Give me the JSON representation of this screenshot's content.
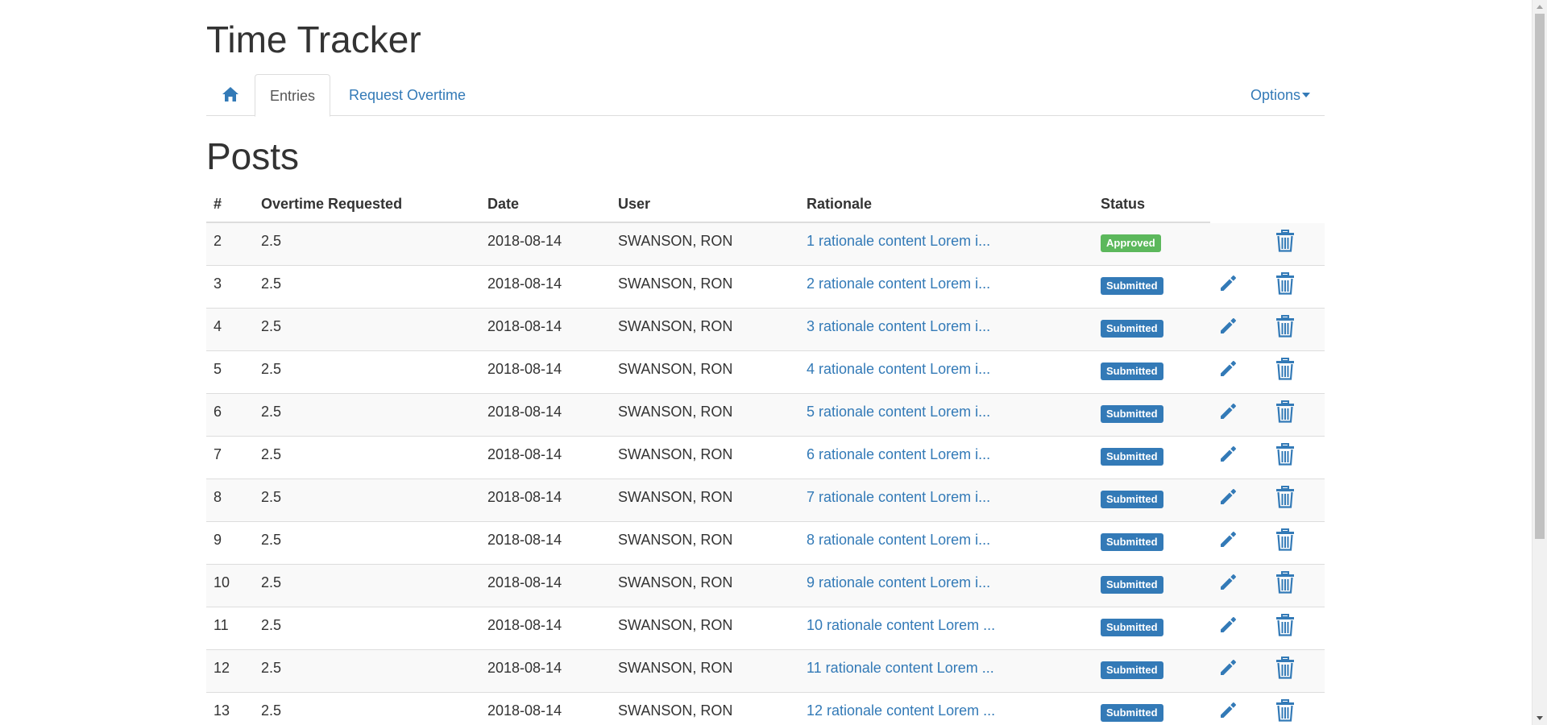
{
  "app": {
    "title": "Time Tracker"
  },
  "nav": {
    "home_icon": "home-icon",
    "tabs": [
      {
        "label": "Entries",
        "active": true
      },
      {
        "label": "Request Overtime",
        "active": false
      }
    ],
    "options_label": "Options"
  },
  "page": {
    "title": "Posts"
  },
  "table": {
    "headers": [
      "#",
      "Overtime Requested",
      "Date",
      "User",
      "Rationale",
      "Status"
    ],
    "rows": [
      {
        "num": "2",
        "overtime": "2.5",
        "date": "2018-08-14",
        "user": "SWANSON, RON",
        "rationale": "1 rationale content Lorem i...",
        "status": "Approved",
        "editable": false
      },
      {
        "num": "3",
        "overtime": "2.5",
        "date": "2018-08-14",
        "user": "SWANSON, RON",
        "rationale": "2 rationale content Lorem i...",
        "status": "Submitted",
        "editable": true
      },
      {
        "num": "4",
        "overtime": "2.5",
        "date": "2018-08-14",
        "user": "SWANSON, RON",
        "rationale": "3 rationale content Lorem i...",
        "status": "Submitted",
        "editable": true
      },
      {
        "num": "5",
        "overtime": "2.5",
        "date": "2018-08-14",
        "user": "SWANSON, RON",
        "rationale": "4 rationale content Lorem i...",
        "status": "Submitted",
        "editable": true
      },
      {
        "num": "6",
        "overtime": "2.5",
        "date": "2018-08-14",
        "user": "SWANSON, RON",
        "rationale": "5 rationale content Lorem i...",
        "status": "Submitted",
        "editable": true
      },
      {
        "num": "7",
        "overtime": "2.5",
        "date": "2018-08-14",
        "user": "SWANSON, RON",
        "rationale": "6 rationale content Lorem i...",
        "status": "Submitted",
        "editable": true
      },
      {
        "num": "8",
        "overtime": "2.5",
        "date": "2018-08-14",
        "user": "SWANSON, RON",
        "rationale": "7 rationale content Lorem i...",
        "status": "Submitted",
        "editable": true
      },
      {
        "num": "9",
        "overtime": "2.5",
        "date": "2018-08-14",
        "user": "SWANSON, RON",
        "rationale": "8 rationale content Lorem i...",
        "status": "Submitted",
        "editable": true
      },
      {
        "num": "10",
        "overtime": "2.5",
        "date": "2018-08-14",
        "user": "SWANSON, RON",
        "rationale": "9 rationale content Lorem i...",
        "status": "Submitted",
        "editable": true
      },
      {
        "num": "11",
        "overtime": "2.5",
        "date": "2018-08-14",
        "user": "SWANSON, RON",
        "rationale": "10 rationale content Lorem ...",
        "status": "Submitted",
        "editable": true
      },
      {
        "num": "12",
        "overtime": "2.5",
        "date": "2018-08-14",
        "user": "SWANSON, RON",
        "rationale": "11 rationale content Lorem ...",
        "status": "Submitted",
        "editable": true
      },
      {
        "num": "13",
        "overtime": "2.5",
        "date": "2018-08-14",
        "user": "SWANSON, RON",
        "rationale": "12 rationale content Lorem ...",
        "status": "Submitted",
        "editable": true
      }
    ]
  },
  "colors": {
    "link": "#337ab7",
    "approved": "#5cb85c",
    "submitted": "#337ab7",
    "text": "#333333"
  },
  "icons": {
    "edit": "pencil-icon",
    "delete": "trash-icon"
  }
}
